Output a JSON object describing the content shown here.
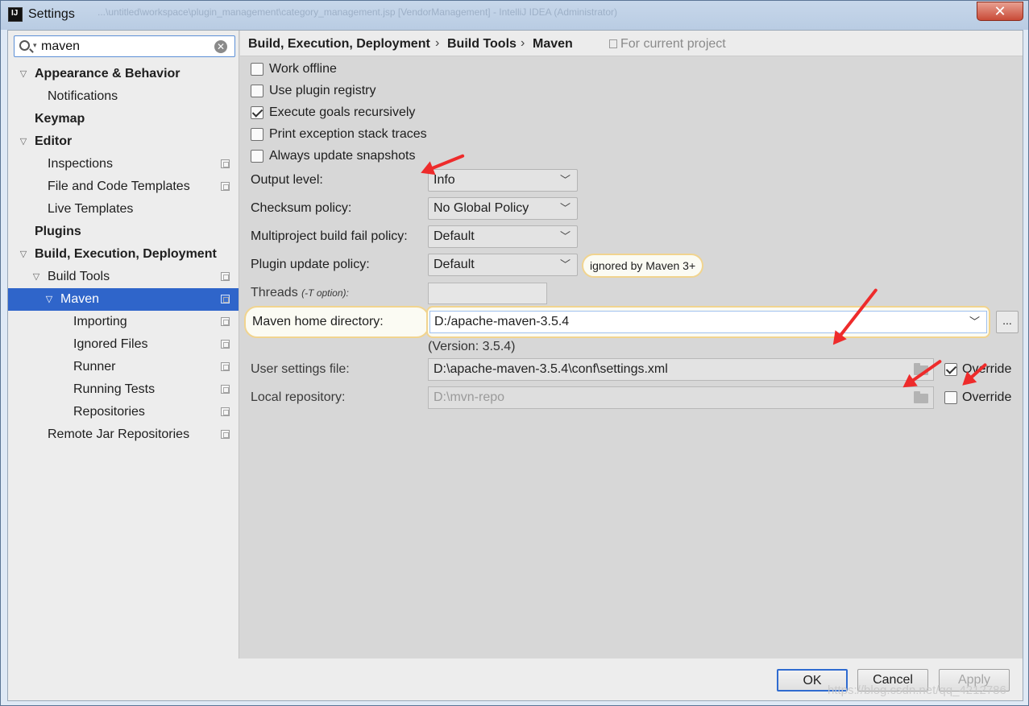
{
  "window": {
    "title": "Settings",
    "blurred_title": "...\\untitled\\workspace\\plugin_management\\category_management.jsp [VendorManagement] - IntelliJ IDEA (Administrator)",
    "close_label": "✕"
  },
  "sidebar": {
    "search_value": "maven",
    "tree": [
      {
        "label": "Appearance & Behavior",
        "bold": true,
        "expanded": true,
        "level": 0
      },
      {
        "label": "Notifications",
        "bold": false,
        "level": 1
      },
      {
        "label": "Keymap",
        "bold": true,
        "level": 0
      },
      {
        "label": "Editor",
        "bold": true,
        "expanded": true,
        "level": 0
      },
      {
        "label": "Inspections",
        "bold": false,
        "level": 1,
        "project": true
      },
      {
        "label": "File and Code Templates",
        "bold": false,
        "level": 1,
        "project": true
      },
      {
        "label": "Live Templates",
        "bold": false,
        "level": 1
      },
      {
        "label": "Plugins",
        "bold": true,
        "level": 0
      },
      {
        "label": "Build, Execution, Deployment",
        "bold": true,
        "expanded": true,
        "level": 0
      },
      {
        "label": "Build Tools",
        "bold": false,
        "expanded": true,
        "level": 1,
        "project": true
      },
      {
        "label": "Maven",
        "bold": false,
        "expanded": true,
        "level": 2,
        "project": true,
        "selected": true
      },
      {
        "label": "Importing",
        "bold": false,
        "level": 3,
        "project": true
      },
      {
        "label": "Ignored Files",
        "bold": false,
        "level": 3,
        "project": true
      },
      {
        "label": "Runner",
        "bold": false,
        "level": 3,
        "project": true
      },
      {
        "label": "Running Tests",
        "bold": false,
        "level": 3,
        "project": true
      },
      {
        "label": "Repositories",
        "bold": false,
        "level": 3,
        "project": true
      },
      {
        "label": "Remote Jar Repositories",
        "bold": false,
        "level": 1,
        "project": true
      }
    ]
  },
  "breadcrumb": {
    "items": [
      "Build, Execution, Deployment",
      "Build Tools",
      "Maven"
    ],
    "separator": "›",
    "scope": "For current project"
  },
  "checkboxes": [
    {
      "label": "Work offline",
      "checked": false
    },
    {
      "label": "Use plugin registry",
      "checked": false
    },
    {
      "label": "Execute goals recursively",
      "checked": true
    },
    {
      "label": "Print exception stack traces",
      "checked": false
    },
    {
      "label": "Always update snapshots",
      "checked": false
    }
  ],
  "fields": {
    "output_level": {
      "label": "Output level:",
      "value": "Info"
    },
    "checksum_policy": {
      "label": "Checksum policy:",
      "value": "No Global Policy"
    },
    "multiproject_fail": {
      "label": "Multiproject build fail policy:",
      "value": "Default"
    },
    "plugin_update": {
      "label": "Plugin update policy:",
      "value": "Default",
      "note": "ignored by Maven 3+"
    },
    "threads": {
      "label": "Threads",
      "hint": "(-T option):",
      "value": ""
    },
    "maven_home": {
      "label": "Maven home directory:",
      "value": "D:/apache-maven-3.5.4",
      "version": "(Version: 3.5.4)",
      "browse_label": "..."
    },
    "user_settings": {
      "label": "User settings file:",
      "value": "D:\\apache-maven-3.5.4\\conf\\settings.xml",
      "override_label": "Override",
      "override_checked": true
    },
    "local_repo": {
      "label": "Local repository:",
      "value": "D:\\mvn-repo",
      "override_label": "Override",
      "override_checked": false
    }
  },
  "footer": {
    "help_label": "?",
    "ok_label": "OK",
    "cancel_label": "Cancel",
    "apply_label": "Apply"
  },
  "watermark": "https://blog.csdn.net/qq_4212786",
  "colors": {
    "selection": "#2f65ca",
    "annotation_red": "#ee2b2b",
    "highlight_border": "#f1d48f",
    "help_blue": "#1a73d9"
  }
}
